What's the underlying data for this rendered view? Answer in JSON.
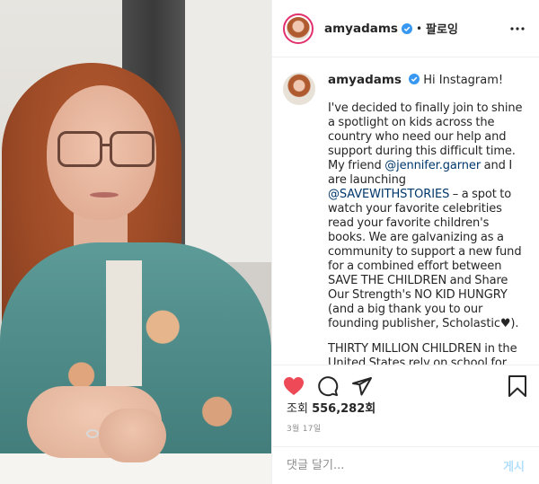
{
  "header": {
    "username": "amyadams",
    "separator": "•",
    "follow_label": "팔로잉"
  },
  "caption": {
    "username": "amyadams",
    "greeting": "Hi Instagram!",
    "para1_before_mention1": "I've decided to finally join to shine a spotlight on kids across the country who need our help and support during this difficult time. My friend ",
    "mention1": "@jennifer.garner",
    "para1_between": " and I are launching ",
    "mention2": "@SAVEWITHSTORIES",
    "para1_after": " – a spot to watch your favorite celebrities read your favorite children's books. We are galvanizing as a community to support a new fund for a combined effort between SAVE THE CHILDREN and Share Our Strength's NO KID HUNGRY (and a big thank you to our founding publisher, Scholastic♥).",
    "para2": "THIRTY MILLION CHILDREN in the United States rely on school for food. School closures will hit vulnerable"
  },
  "stats": {
    "views_label": "조회",
    "views_count": "556,282회",
    "date": "3월 17일"
  },
  "comment_box": {
    "placeholder": "댓글 달기...",
    "post_label": "게시"
  },
  "colors": {
    "like_red": "#ed4956",
    "verified_blue": "#3897f0",
    "mention_blue": "#00376b",
    "post_disabled": "#b2dffc"
  },
  "icons": [
    "heart-icon",
    "comment-icon",
    "share-icon",
    "bookmark-icon",
    "more-icon",
    "verified-badge-icon"
  ]
}
